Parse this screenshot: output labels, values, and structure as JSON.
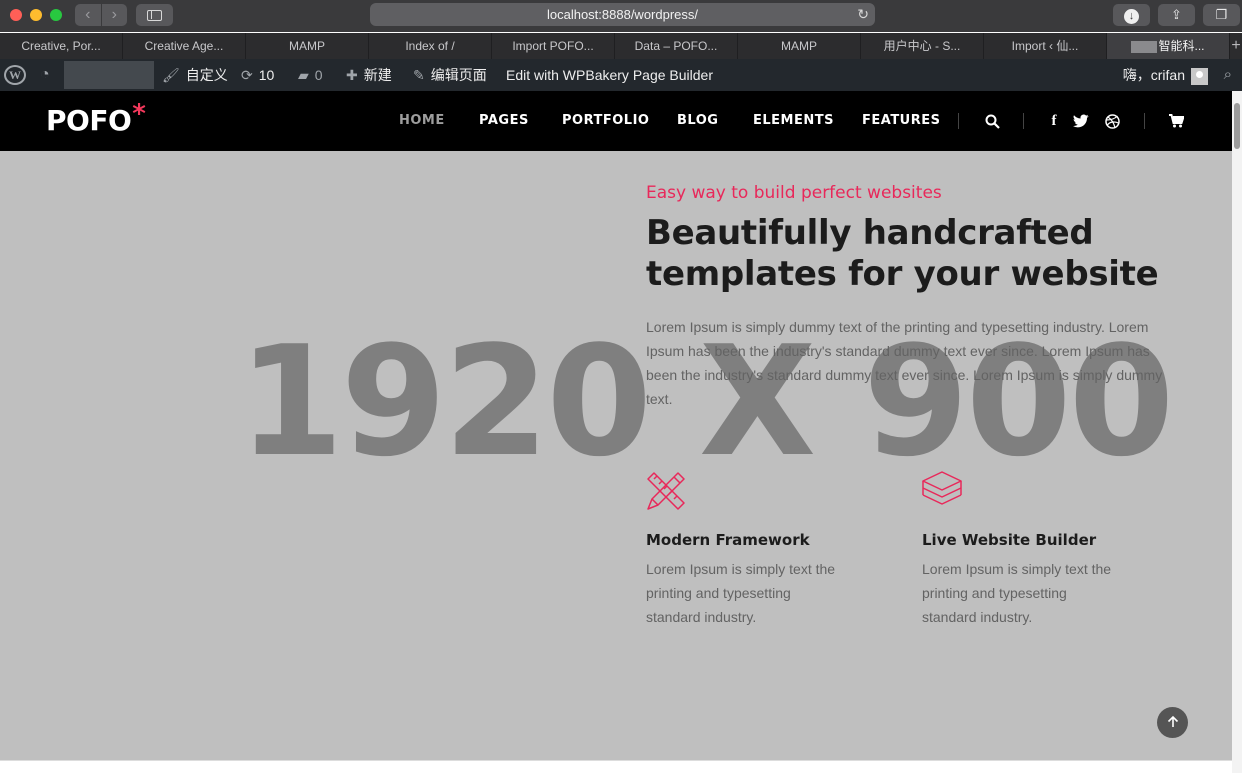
{
  "browser": {
    "url": "localhost:8888/wordpress/",
    "tabs": [
      {
        "label": "Creative, Por..."
      },
      {
        "label": "Creative Age..."
      },
      {
        "label": "MAMP"
      },
      {
        "label": "Index of /"
      },
      {
        "label": "Import POFO..."
      },
      {
        "label": "Data – POFO..."
      },
      {
        "label": "MAMP"
      },
      {
        "label": "用户中心 - S..."
      },
      {
        "label": "Import ‹ 仙..."
      },
      {
        "label": "智能科..."
      }
    ],
    "new_tab_label": "+"
  },
  "admin_bar": {
    "customize": "自定义",
    "updates_count": "10",
    "comments_count": "0",
    "new_label": "新建",
    "edit_page": "编辑页面",
    "wpbakery": "Edit with WPBakery Page Builder",
    "howdy": "嗨，crifan"
  },
  "header": {
    "logo": "POFO",
    "logo_mark": "*",
    "menu": {
      "home": "HOME",
      "pages": "PAGES",
      "portfolio": "PORTFOLIO",
      "blog": "BLOG",
      "elements": "ELEMENTS",
      "features": "FEATURES"
    }
  },
  "hero": {
    "placeholder": "1920 X 900",
    "eyebrow": "Easy way to build perfect websites",
    "headline": "Beautifully handcrafted templates for your website",
    "paragraph": "Lorem Ipsum is simply dummy text of the printing and typesetting industry. Lorem Ipsum has been the industry's standard dummy text ever since. Lorem Ipsum has been the industry's standard dummy text ever since. Lorem Ipsum is simply dummy text.",
    "features": [
      {
        "icon": "pencil-ruler-icon",
        "title": "Modern Framework",
        "text": "Lorem Ipsum is simply text the printing and typesetting standard industry."
      },
      {
        "icon": "layers-icon",
        "title": "Live Website Builder",
        "text": "Lorem Ipsum is simply text the printing and typesetting standard industry."
      }
    ]
  },
  "colors": {
    "accent": "#e8285a",
    "header_bg": "#000000",
    "admin_bar_bg": "#23282d",
    "hero_bg": "#bfbfbf"
  }
}
